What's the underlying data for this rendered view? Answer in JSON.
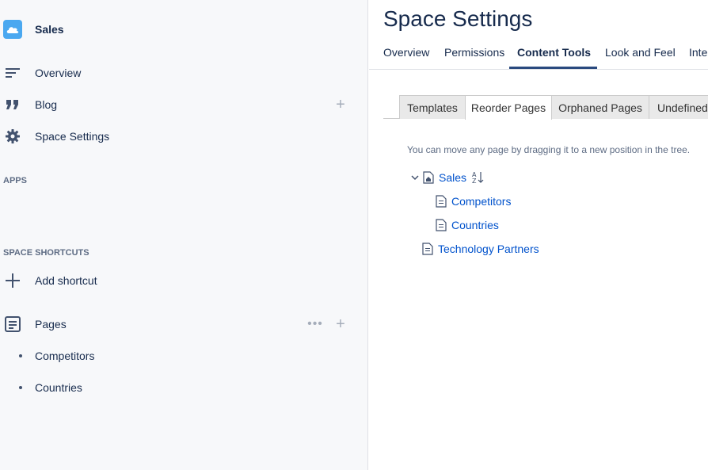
{
  "sidebar": {
    "space_name": "Sales",
    "nav": [
      {
        "label": "Overview",
        "icon": "overview-lines-icon"
      },
      {
        "label": "Blog",
        "icon": "quote-icon"
      },
      {
        "label": "Space Settings",
        "icon": "gear-icon"
      }
    ],
    "apps_heading": "APPS",
    "shortcuts_heading": "SPACE SHORTCUTS",
    "add_shortcut": "Add shortcut",
    "pages_label": "Pages",
    "page_children": [
      "Competitors",
      "Countries"
    ]
  },
  "main": {
    "title": "Space Settings",
    "tabs": [
      "Overview",
      "Permissions",
      "Content Tools",
      "Look and Feel",
      "Inte"
    ],
    "active_tab": "Content Tools",
    "subtabs": [
      "Templates",
      "Reorder Pages",
      "Orphaned Pages",
      "Undefined"
    ],
    "active_subtab": "Reorder Pages",
    "hint": "You can move any page by dragging it to a new position in the tree.",
    "tree": {
      "root": "Sales",
      "children": [
        "Competitors",
        "Countries"
      ],
      "sibling": "Technology Partners"
    }
  },
  "colors": {
    "accent_underline": "#2a4a7f",
    "link": "#0052cc",
    "sidebar_bg": "#f7f8fa",
    "logo": "#4aa8f0"
  }
}
